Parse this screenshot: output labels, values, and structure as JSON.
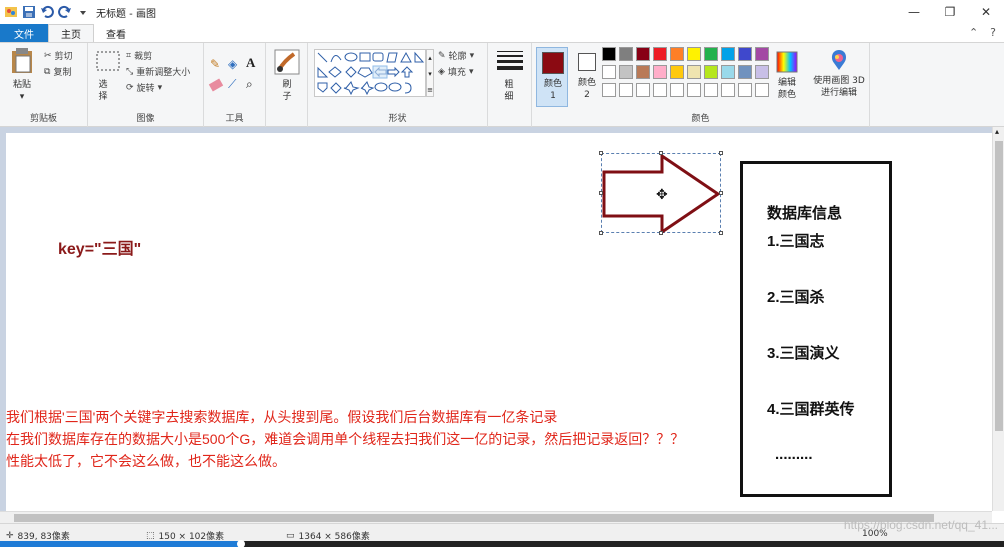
{
  "window": {
    "title": "无标题 - 画图",
    "controls": [
      "—",
      "❐",
      "✕"
    ]
  },
  "tabs": [
    {
      "label": "文件"
    },
    {
      "label": "主页"
    },
    {
      "label": "查看"
    }
  ],
  "ribbon": {
    "clipboard": {
      "label": "剪贴板",
      "paste": "粘贴",
      "cut": "剪切",
      "copy": "复制"
    },
    "image": {
      "label": "图像",
      "select": "选择",
      "crop": "裁剪",
      "resize": "重新调整大小",
      "rotate": "旋转"
    },
    "tools": {
      "label": "工具"
    },
    "brushes": {
      "label": "刷子"
    },
    "shapes": {
      "label": "形状",
      "outline": "轮廓",
      "fill": "填充"
    },
    "size": {
      "label": "粗细"
    },
    "colors": {
      "label": "颜色",
      "color1": "颜色 1",
      "color2": "颜色 2",
      "edit": "编辑颜色",
      "paint3d": "使用画图 3D 进行编辑",
      "primary": "#8b0a12",
      "secondary": "#ffffff",
      "palette_row1": [
        "#000000",
        "#7f7f7f",
        "#880015",
        "#ed1c24",
        "#ff7f27",
        "#fff200",
        "#22b14c",
        "#00a2e8",
        "#3f48cc",
        "#a349a4"
      ],
      "palette_row2": [
        "#ffffff",
        "#c3c3c3",
        "#b97a57",
        "#ffaec9",
        "#ffc90e",
        "#efe4b0",
        "#b5e61d",
        "#99d9ea",
        "#7092be",
        "#c8bfe7"
      ]
    }
  },
  "canvas": {
    "key_text": "key=\"三国\"",
    "paragraph": [
      "我们根据'三国'两个关键字去搜索数据库，从头搜到尾。假设我们后台数据库有一亿条记录",
      "在我们数据库存在的数据大小是500个G，难道会调用单个线程去扫我们这一亿的记录，然后把记录返回？？？",
      "性能太低了，它不会这么做，也不能这么做。"
    ],
    "db_box": {
      "title": "数据库信息",
      "items": [
        "1.三国志",
        "2.三国杀",
        "3.三国演义",
        "4.三国群英传"
      ],
      "ellipsis": "........."
    },
    "arrow_color": "#7f0f14"
  },
  "status": {
    "cursor_pos": "839, 83像素",
    "selection_size": "150 × 102像素",
    "image_size": "1364 × 586像素",
    "zoom": "100%"
  },
  "video": {
    "progress_percent": 24
  },
  "watermark": "https://blog.csdn.net/qq_41..."
}
